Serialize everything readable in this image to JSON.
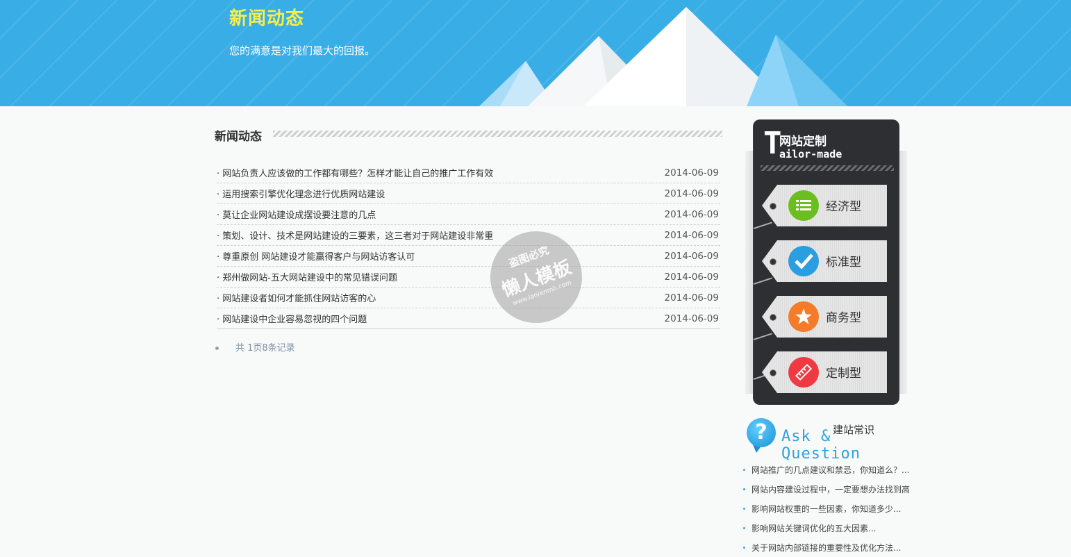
{
  "banner": {
    "title": "新闻动态",
    "subtitle": "您的满意是对我们最大的回报。"
  },
  "news": {
    "section_title": "新闻动态",
    "items": [
      {
        "title": "· 网站负责人应该做的工作都有哪些？怎样才能让自己的推广工作有效",
        "date": "2014-06-09"
      },
      {
        "title": "· 运用搜索引擎优化理念进行优质网站建设",
        "date": "2014-06-09"
      },
      {
        "title": "· 莫让企业网站建设成摆设要注意的几点",
        "date": "2014-06-09"
      },
      {
        "title": "· 策划、设计、技术是网站建设的三要素，这三者对于网站建设非常重",
        "date": "2014-06-09"
      },
      {
        "title": "· 尊重原创 网站建设才能赢得客户与网站访客认可",
        "date": "2014-06-09"
      },
      {
        "title": "· 郑州做网站-五大网站建设中的常见错误问题",
        "date": "2014-06-09"
      },
      {
        "title": "· 网站建设者如何才能抓住网站访客的心",
        "date": "2014-06-09"
      },
      {
        "title": "· 网站建设中企业容易忽视的四个问题",
        "date": "2014-06-09"
      }
    ],
    "pager_text": "共 1页8条记录"
  },
  "watermark": {
    "line1": "盗图必究",
    "line2": "懒人模板",
    "line3": "www.lanrenmb.com"
  },
  "tailor": {
    "big_letter": "T",
    "title_cn": "网站定制",
    "title_en": "ailor-made",
    "tags": [
      {
        "label": "经济型",
        "icon": "list-icon",
        "color": "#6abf1e"
      },
      {
        "label": "标准型",
        "icon": "check-icon",
        "color": "#2a9ee0"
      },
      {
        "label": "商务型",
        "icon": "star-icon",
        "color": "#f47b2a"
      },
      {
        "label": "定制型",
        "icon": "ruler-icon",
        "color": "#ef3a43"
      }
    ]
  },
  "qa": {
    "icon_glyph": "?",
    "title_en": "Ask & Question",
    "title_cn": "建站常识",
    "items": [
      "网站推广的几点建议和禁忌，你知道么？...",
      "网站内容建设过程中，一定要想办法找到高",
      "影响网站权重的一些因素，你知道多少...",
      "影响网站关键词优化的五大因素...",
      "关于网站内部链接的重要性及优化方法..."
    ]
  },
  "colors": {
    "banner_blue": "#39aee6",
    "banner_title_yellow": "#f6ef4a",
    "panel_dark": "#2d2f33"
  }
}
